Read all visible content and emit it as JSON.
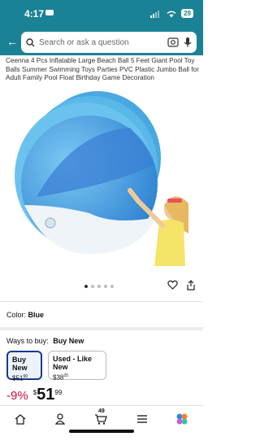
{
  "status_bar": {
    "time": "4:17",
    "battery": "29"
  },
  "search": {
    "placeholder": "Search or ask a question"
  },
  "product": {
    "title": "Ceenna 4 Pcs Inflatable Large Beach Ball 5 Feet Giant Pool Toy Balls Summer Swimming Toys Parties PVC Plastic Jumbo Ball for Adult Family Pool Float Birthday Game Decoration",
    "image_carousel": {
      "count": 5,
      "active_index": 0
    },
    "color_label": "Color:",
    "color_value": "Blue"
  },
  "ways_to_buy": {
    "label": "Ways to buy:",
    "selected": "Buy New",
    "options": [
      {
        "label": "Buy New",
        "price_dollars": "$51",
        "price_cents": "99"
      },
      {
        "label": "Used - Like New",
        "price_dollars": "$38",
        "price_cents": "20"
      }
    ]
  },
  "price": {
    "discount": "-9%",
    "currency": "$",
    "dollars": "51",
    "cents": "99"
  },
  "bottom_nav": {
    "cart_count": "49"
  },
  "colors": {
    "header": "#1a8294",
    "discount": "#cc0c39",
    "selected_border": "#1a3a8a"
  }
}
